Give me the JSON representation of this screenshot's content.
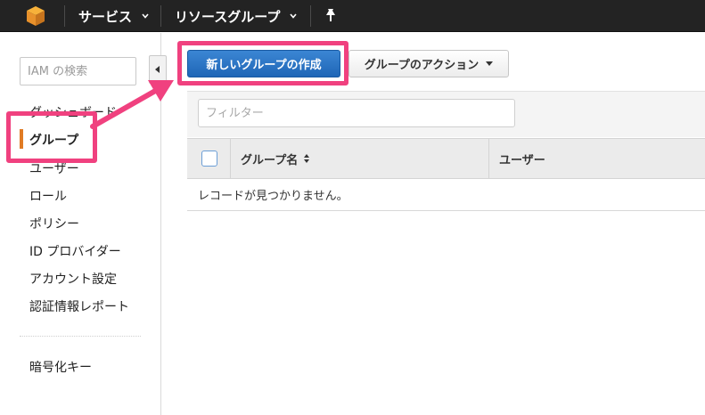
{
  "topbar": {
    "logo_icon": "aws-cube-icon",
    "services_label": "サービス",
    "resource_groups_label": "リソースグループ",
    "chevron_icon": "chevron-down-icon",
    "pin_icon": "pin-icon"
  },
  "sidebar": {
    "search_placeholder": "IAM の検索",
    "collapse_icon": "chevron-left-icon",
    "items": [
      {
        "label": "ダッシュボード",
        "active": false
      },
      {
        "label": "グループ",
        "active": true
      },
      {
        "label": "ユーザー",
        "active": false
      },
      {
        "label": "ロール",
        "active": false
      },
      {
        "label": "ポリシー",
        "active": false
      },
      {
        "label": "ID プロバイダー",
        "active": false
      },
      {
        "label": "アカウント設定",
        "active": false
      },
      {
        "label": "認証情報レポート",
        "active": false
      }
    ],
    "encryption_label": "暗号化キー"
  },
  "main": {
    "create_group_label": "新しいグループの作成",
    "group_actions_label": "グループのアクション",
    "filter_placeholder": "フィルター",
    "table": {
      "columns": [
        "グループ名",
        "ユーザー"
      ],
      "empty_message": "レコードが見つかりません。"
    }
  },
  "colors": {
    "topbar": "#232323",
    "primary_button": "#2a75c7",
    "highlight": "#f0417f",
    "active_marker": "#e07b24"
  }
}
